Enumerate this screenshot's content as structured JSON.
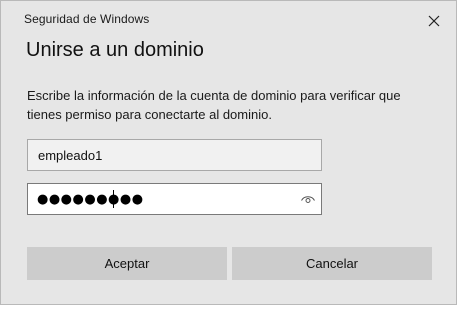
{
  "window": {
    "title": "Seguridad de Windows",
    "close_icon": "close-icon"
  },
  "dialog": {
    "heading": "Unirse a un dominio",
    "description": "Escribe la información de la cuenta de dominio para verificar que tienes permiso para conectarte al dominio."
  },
  "form": {
    "username_value": "empleado1",
    "password_masked": "●●●●●●●●●",
    "reveal_icon": "eye-icon"
  },
  "buttons": {
    "ok_label": "Aceptar",
    "cancel_label": "Cancelar"
  },
  "colors": {
    "background": "#e6e6e6",
    "button": "#cccccc",
    "focused_border": "#7a7a7a"
  }
}
